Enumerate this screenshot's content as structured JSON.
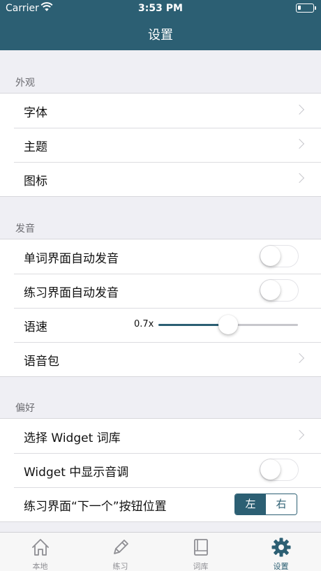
{
  "status_bar": {
    "carrier": "Carrier",
    "time": "3:53 PM"
  },
  "nav": {
    "title": "设置"
  },
  "sections": {
    "appearance": {
      "header": "外观",
      "font_label": "字体",
      "theme_label": "主题",
      "icon_label": "图标"
    },
    "pronunciation": {
      "header": "发音",
      "word_auto_label": "单词界面自动发音",
      "word_auto_on": false,
      "practice_auto_label": "练习界面自动发音",
      "practice_auto_on": false,
      "speed_label": "语速",
      "speed_value": "0.7x",
      "speed_fraction": 0.5,
      "voice_pack_label": "语音包"
    },
    "preferences": {
      "header": "偏好",
      "widget_library_label": "选择 Widget 词库",
      "widget_tone_label": "Widget 中显示音调",
      "widget_tone_on": false,
      "next_button_label": "练习界面“下一个”按钮位置",
      "segment": {
        "left": "左",
        "right": "右",
        "selected": "left"
      }
    }
  },
  "tabbar": {
    "tabs": [
      {
        "label": "本地",
        "icon": "home-icon",
        "active": false
      },
      {
        "label": "练习",
        "icon": "pencil-icon",
        "active": false
      },
      {
        "label": "词库",
        "icon": "book-icon",
        "active": false
      },
      {
        "label": "设置",
        "icon": "gear-icon",
        "active": true
      }
    ]
  },
  "colors": {
    "accent": "#2c5f73",
    "background": "#efeff4",
    "inactive": "#8e8e93"
  }
}
